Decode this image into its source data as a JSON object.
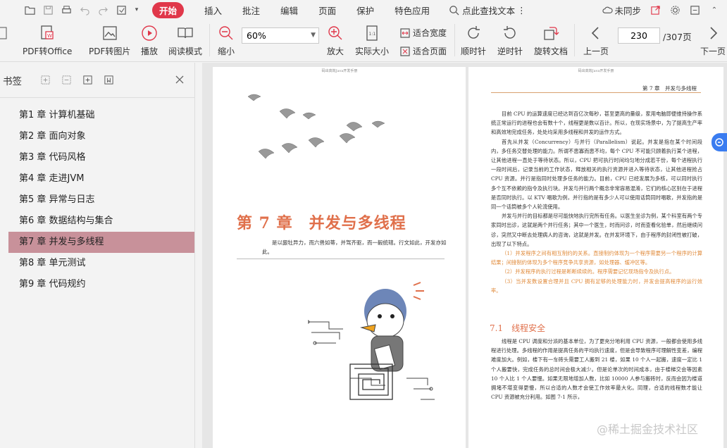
{
  "menu": {
    "items": [
      "开始",
      "插入",
      "批注",
      "编辑",
      "页面",
      "保护",
      "特色应用"
    ],
    "find": "点此查找文本",
    "sync": "未同步"
  },
  "toolbar": {
    "pdf_office": "PDF转Office",
    "pdf_image": "PDF转图片",
    "play": "播放",
    "read_mode": "阅读模式",
    "zoom_out": "缩小",
    "zoom_value": "60%",
    "zoom_in": "放大",
    "actual_size": "实际大小",
    "fit_width": "适合宽度",
    "fit_page": "适合页面",
    "rotate_cw": "顺时针",
    "rotate_ccw": "逆时针",
    "rotate_doc": "旋转文档",
    "prev_page": "上一页",
    "page_current": "230",
    "page_total": "/307页",
    "next_page": "下一页"
  },
  "sidebar": {
    "title": "书签",
    "bookmarks": [
      "第1 章 计算机基础",
      "第2 章 面向对象",
      "第3 章 代码风格",
      "第4 章 走进JVM",
      "第5 章 异常与日志",
      "第6 章 数据结构与集合",
      "第7 章 并发与多线程",
      "第8 章 单元测试",
      "第9 章 代码规约"
    ],
    "active_index": 6
  },
  "doc": {
    "page1": {
      "header": "码出高效Java开发手册",
      "chapter_title": "第 7 章　并发与多线程",
      "intro": "是以狠牡异力，而六兽如蒂，并驾齐驱，而一毅统辖。行文如此，开发亦如此。"
    },
    "page2": {
      "header_top": "码出高效Java开发手册",
      "running_head": "第 7 章　并发与多线程",
      "paras": [
        "目前 CPU 的运算速度已经达到百亿次每秒，甚至更高的量级，家用电脑即便维持操作系统正常运行的进程也会有数十个，线程更是数以百计。所以，在现实场景中，为了提高生产率和高效地完成任务，处处均采用多线程和并发的运作方式。",
        "首先从并发（Concurrency）与并行（Parallelism）说起。并发是指在某个时间段内，多任务交替处理的能力。所谓不患寡而患不均，每个 CPU 不可能只顾着执行某个进程，让其他进程一直处于等待状态。所以，CPU 把可执行时间均匀地分成若干份，每个进程执行一段时间后，记录当前的工作状态，释放相关的执行资源并进入等待状态，让其他进程抢占 CPU 资源。并行是指同时处理多任务的能力。目前，CPU 已经发展为多核，可以同时执行多个互不依赖的指令及执行块。并发与并行两个概念非常容易混淆，它们的核心区别在于进程是否同时执行。以 KTV 唱歌为例，并行指的是有多少人可以使用话筒同时唱歌，并发指的是同一个话筒被多个人轮流使用。",
        "并发与并行的目标都是尽可能快地执行完所有任务。以医生坐诊为例，某个科室有两个专家同时出诊，这就是两个并行任务；其中一个医生，时而问诊，时而查看化验单，然后继续问诊，突然又中断去处理病人的咨询，这就是并发。在并发环境下，由于程序的封闭性被打破，出现了以下特点。"
      ],
      "highlights": [
        "（1）并发程序之间有相互制约的关系。直接制约体现为一个程序需要另一个程序的计算结果；间接制约体现为多个程序竞争共享资源，如处理器、缓冲区等。",
        "（2）并发程序的执行过程是断断续续的。程序需要记忆现场指令及执行点。",
        "（3）当并发数设置合理并且 CPU 拥有足够的处理能力时，并发会提高程序的运行效率。"
      ],
      "section_title": "7.1　线程安全",
      "paras2": [
        "线程是 CPU 调度和分派的基本单位，为了更充分地利用 CPU 资源，一般都会使用多线程进行处理。多线程的作用是提高任务的平均执行速度，但是会导致程序可理解性变差，编程难度加大。例如，楼下有一车砖头需要工人搬到 21 楼，如果 10 个人一起搬，速度一定比 1 个人搬要快，完成任务的总时间会极大减少。但是论单次的时间成本，由于楼梯交会等因素 10 个人比 1 个人要慢。如果无限地增加人数，比如 10000 人参与搬砖时，反而会因为楼道拥堵不堪变得更慢，所以合适的人数才会使工作效率最大化。同理，合适的线程数才能让 CPU 资源被充分利用。如图 7-1 所示，"
      ]
    }
  },
  "watermark": "@稀土掘金技术社区",
  "colors": {
    "accent": "#e0374a",
    "chapter": "#e0704b",
    "bookmark_active": "#c8919a"
  }
}
